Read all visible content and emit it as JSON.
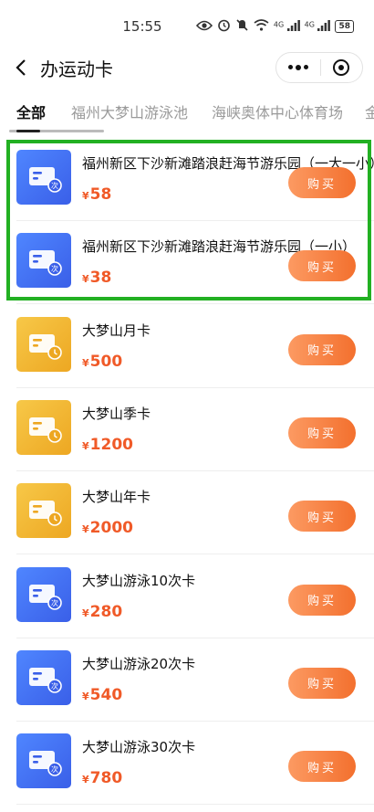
{
  "status_bar": {
    "time": "15:55",
    "network_1": "4G",
    "network_2": "4G",
    "battery": "58"
  },
  "nav": {
    "title": "办运动卡"
  },
  "tabs": [
    "全部",
    "福州大梦山游泳池",
    "海峡奥体中心体育场",
    "金"
  ],
  "buy_label": "购买",
  "currency_symbol": "¥",
  "cards": [
    {
      "name": "福州新区下沙新滩踏浪赶海节游乐园（一大一小）",
      "price": "58",
      "icon_color": "blue",
      "icon": "times-card-icon"
    },
    {
      "name": "福州新区下沙新滩踏浪赶海节游乐园（一小）",
      "price": "38",
      "icon_color": "blue",
      "icon": "times-card-icon"
    },
    {
      "name": "大梦山月卡",
      "price": "500",
      "icon_color": "gold",
      "icon": "period-card-icon"
    },
    {
      "name": "大梦山季卡",
      "price": "1200",
      "icon_color": "gold",
      "icon": "period-card-icon"
    },
    {
      "name": "大梦山年卡",
      "price": "2000",
      "icon_color": "gold",
      "icon": "period-card-icon"
    },
    {
      "name": "大梦山游泳10次卡",
      "price": "280",
      "icon_color": "blue",
      "icon": "times-card-icon"
    },
    {
      "name": "大梦山游泳20次卡",
      "price": "540",
      "icon_color": "blue",
      "icon": "times-card-icon"
    },
    {
      "name": "大梦山游泳30次卡",
      "price": "780",
      "icon_color": "blue",
      "icon": "times-card-icon"
    }
  ],
  "colors": {
    "price": "#f05a28",
    "button": "#f3702e",
    "highlight": "#22b022",
    "icon_blue": "#3a5fe8",
    "icon_gold": "#eda722"
  }
}
